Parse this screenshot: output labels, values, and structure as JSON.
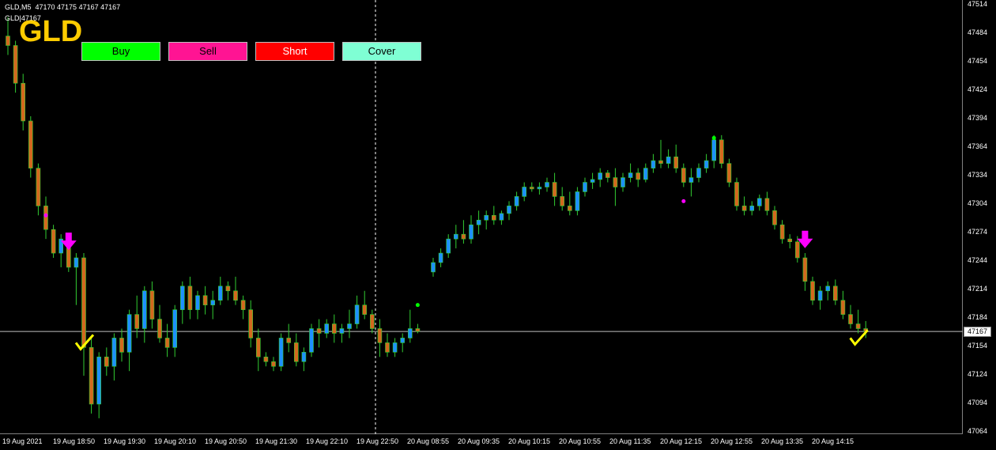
{
  "window": {
    "info_line1": "GLD,M5  47170 47175 47167 47167",
    "info_line2": "GLD|47167",
    "symbol": "GLD"
  },
  "buttons": [
    {
      "label": "Buy",
      "bg": "#00ff00",
      "fg": "#000000"
    },
    {
      "label": "Sell",
      "bg": "#ff1493",
      "fg": "#000000"
    },
    {
      "label": "Short",
      "bg": "#ff0000",
      "fg": "#ffffff"
    },
    {
      "label": "Cover",
      "bg": "#7fffd4",
      "fg": "#000000"
    }
  ],
  "price_axis": [
    "47514",
    "47484",
    "47454",
    "47424",
    "47394",
    "47364",
    "47334",
    "47304",
    "47274",
    "47244",
    "47214",
    "47184",
    "47154",
    "47124",
    "47094",
    "47064"
  ],
  "current_price": "47167",
  "time_axis": [
    "19 Aug 2021",
    "19 Aug 18:50",
    "19 Aug 19:30",
    "19 Aug 20:10",
    "19 Aug 20:50",
    "19 Aug 21:30",
    "19 Aug 22:10",
    "19 Aug 22:50",
    "20 Aug 08:55",
    "20 Aug 09:35",
    "20 Aug 10:15",
    "20 Aug 10:55",
    "20 Aug 11:35",
    "20 Aug 12:15",
    "20 Aug 12:55",
    "20 Aug 13:35",
    "20 Aug 14:15"
  ],
  "colors": {
    "bull_body": "#1e90ff",
    "bear_body": "#d2691e",
    "wick": "#32cd32",
    "price_line": "#c0c0c0",
    "arrow": "#ff00ff",
    "check": "#ffff00"
  },
  "chart_data": {
    "type": "candlestick",
    "ylim": [
      47064,
      47514
    ],
    "current_price": 47167,
    "candles": [
      [
        47480,
        47500,
        47460,
        47470
      ],
      [
        47470,
        47475,
        47420,
        47430
      ],
      [
        47430,
        47440,
        47380,
        47390
      ],
      [
        47390,
        47395,
        47330,
        47340
      ],
      [
        47340,
        47345,
        47290,
        47300
      ],
      [
        47300,
        47310,
        47265,
        47275
      ],
      [
        47275,
        47280,
        47245,
        47250
      ],
      [
        47250,
        47270,
        47235,
        47265
      ],
      [
        47265,
        47268,
        47230,
        47235
      ],
      [
        47235,
        47250,
        47195,
        47245
      ],
      [
        47245,
        47250,
        47120,
        47150
      ],
      [
        47150,
        47160,
        47080,
        47090
      ],
      [
        47090,
        47145,
        47075,
        47140
      ],
      [
        47140,
        47150,
        47120,
        47130
      ],
      [
        47130,
        47165,
        47115,
        47160
      ],
      [
        47160,
        47170,
        47135,
        47145
      ],
      [
        47145,
        47190,
        47125,
        47185
      ],
      [
        47185,
        47205,
        47160,
        47170
      ],
      [
        47170,
        47215,
        47155,
        47210
      ],
      [
        47210,
        47220,
        47170,
        47180
      ],
      [
        47180,
        47195,
        47155,
        47160
      ],
      [
        47160,
        47175,
        47140,
        47150
      ],
      [
        47150,
        47195,
        47140,
        47190
      ],
      [
        47190,
        47220,
        47175,
        47215
      ],
      [
        47215,
        47225,
        47180,
        47190
      ],
      [
        47190,
        47210,
        47180,
        47205
      ],
      [
        47205,
        47215,
        47185,
        47195
      ],
      [
        47195,
        47210,
        47180,
        47200
      ],
      [
        47200,
        47225,
        47195,
        47215
      ],
      [
        47215,
        47220,
        47200,
        47210
      ],
      [
        47210,
        47225,
        47195,
        47200
      ],
      [
        47200,
        47205,
        47180,
        47190
      ],
      [
        47190,
        47200,
        47150,
        47160
      ],
      [
        47160,
        47170,
        47125,
        47140
      ],
      [
        47140,
        47145,
        47130,
        47135
      ],
      [
        47135,
        47140,
        47125,
        47130
      ],
      [
        47130,
        47165,
        47125,
        47160
      ],
      [
        47160,
        47175,
        47145,
        47155
      ],
      [
        47155,
        47165,
        47130,
        47135
      ],
      [
        47135,
        47150,
        47125,
        47145
      ],
      [
        47145,
        47175,
        47140,
        47170
      ],
      [
        47170,
        47180,
        47150,
        47165
      ],
      [
        47165,
        47180,
        47160,
        47175
      ],
      [
        47175,
        47185,
        47155,
        47165
      ],
      [
        47165,
        47175,
        47155,
        47170
      ],
      [
        47170,
        47190,
        47160,
        47175
      ],
      [
        47175,
        47205,
        47170,
        47195
      ],
      [
        47195,
        47210,
        47180,
        47185
      ],
      [
        47185,
        47190,
        47165,
        47170
      ],
      [
        47170,
        47180,
        47140,
        47155
      ],
      [
        47155,
        47165,
        47140,
        47145
      ],
      [
        47145,
        47160,
        47140,
        47155
      ],
      [
        47155,
        47165,
        47145,
        47160
      ],
      [
        47160,
        47190,
        47155,
        47170
      ],
      [
        47170,
        47175,
        47165,
        47167
      ],
      [
        47230,
        47245,
        47225,
        47240
      ],
      [
        47240,
        47255,
        47235,
        47250
      ],
      [
        47250,
        47270,
        47245,
        47265
      ],
      [
        47265,
        47280,
        47255,
        47270
      ],
      [
        47270,
        47285,
        47260,
        47265
      ],
      [
        47265,
        47290,
        47260,
        47280
      ],
      [
        47280,
        47295,
        47270,
        47285
      ],
      [
        47285,
        47295,
        47275,
        47290
      ],
      [
        47290,
        47300,
        47280,
        47285
      ],
      [
        47285,
        47295,
        47280,
        47292
      ],
      [
        47292,
        47305,
        47285,
        47300
      ],
      [
        47300,
        47315,
        47295,
        47310
      ],
      [
        47310,
        47325,
        47305,
        47320
      ],
      [
        47320,
        47325,
        47315,
        47318
      ],
      [
        47318,
        47325,
        47312,
        47320
      ],
      [
        47320,
        47330,
        47315,
        47325
      ],
      [
        47325,
        47335,
        47300,
        47310
      ],
      [
        47310,
        47320,
        47295,
        47300
      ],
      [
        47300,
        47315,
        47290,
        47295
      ],
      [
        47295,
        47320,
        47290,
        47315
      ],
      [
        47315,
        47330,
        47310,
        47325
      ],
      [
        47325,
        47335,
        47318,
        47328
      ],
      [
        47328,
        47340,
        47320,
        47335
      ],
      [
        47335,
        47338,
        47325,
        47330
      ],
      [
        47330,
        47340,
        47300,
        47320
      ],
      [
        47320,
        47335,
        47315,
        47330
      ],
      [
        47330,
        47345,
        47325,
        47335
      ],
      [
        47335,
        47340,
        47320,
        47328
      ],
      [
        47328,
        47345,
        47325,
        47340
      ],
      [
        47340,
        47355,
        47335,
        47348
      ],
      [
        47348,
        47370,
        47340,
        47345
      ],
      [
        47345,
        47360,
        47340,
        47352
      ],
      [
        47352,
        47365,
        47335,
        47340
      ],
      [
        47340,
        47345,
        47320,
        47325
      ],
      [
        47325,
        47340,
        47310,
        47330
      ],
      [
        47330,
        47345,
        47325,
        47340
      ],
      [
        47340,
        47355,
        47335,
        47348
      ],
      [
        47348,
        47375,
        47340,
        47370
      ],
      [
        47370,
        47375,
        47340,
        47345
      ],
      [
        47345,
        47350,
        47320,
        47325
      ],
      [
        47325,
        47330,
        47295,
        47300
      ],
      [
        47300,
        47310,
        47290,
        47295
      ],
      [
        47295,
        47305,
        47290,
        47300
      ],
      [
        47300,
        47312,
        47295,
        47308
      ],
      [
        47308,
        47315,
        47290,
        47295
      ],
      [
        47295,
        47300,
        47275,
        47280
      ],
      [
        47280,
        47285,
        47260,
        47265
      ],
      [
        47265,
        47270,
        47255,
        47262
      ],
      [
        47262,
        47268,
        47240,
        47245
      ],
      [
        47245,
        47250,
        47210,
        47220
      ],
      [
        47220,
        47225,
        47195,
        47200
      ],
      [
        47200,
        47215,
        47190,
        47210
      ],
      [
        47210,
        47220,
        47200,
        47215
      ],
      [
        47215,
        47222,
        47195,
        47200
      ],
      [
        47200,
        47210,
        47180,
        47185
      ],
      [
        47185,
        47195,
        47170,
        47175
      ],
      [
        47175,
        47190,
        47165,
        47170
      ],
      [
        47170,
        47178,
        47160,
        47167
      ]
    ],
    "markers": [
      {
        "type": "dot",
        "index": 5,
        "price": 47290,
        "color": "#ff00ff"
      },
      {
        "type": "arrow-down",
        "index": 8,
        "price": 47260,
        "color": "#ff00ff"
      },
      {
        "type": "check",
        "index": 10,
        "price": 47155,
        "color": "#ffff00"
      },
      {
        "type": "dot",
        "index": 54,
        "price": 47195,
        "color": "#00ff00"
      },
      {
        "type": "dot",
        "index": 92,
        "price": 47372,
        "color": "#00ff00"
      },
      {
        "type": "dot",
        "index": 88,
        "price": 47305,
        "color": "#ff00ff"
      },
      {
        "type": "arrow-down",
        "index": 104,
        "price": 47262,
        "color": "#ff00ff"
      },
      {
        "type": "check",
        "index": 111,
        "price": 47160,
        "color": "#ffff00"
      }
    ]
  }
}
